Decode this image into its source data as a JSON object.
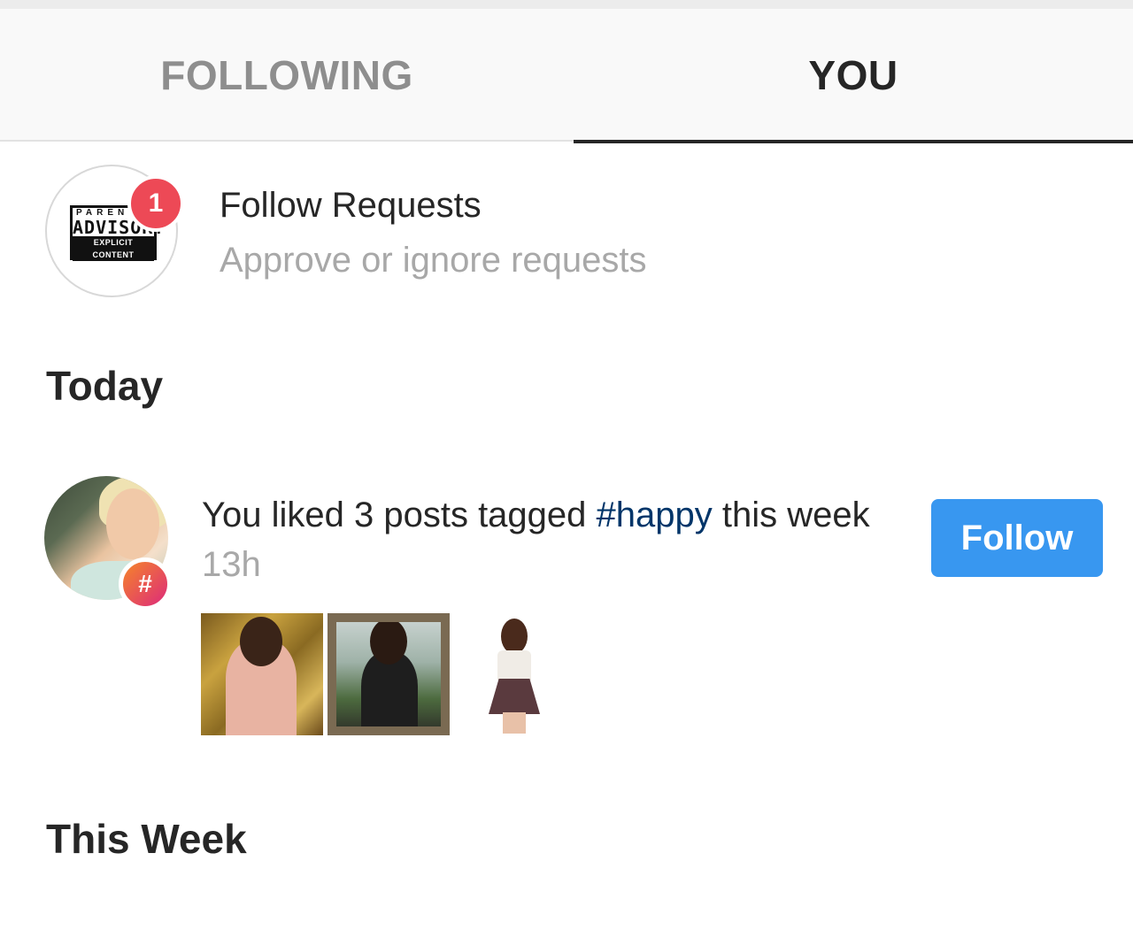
{
  "tabs": {
    "following_label": "FOLLOWING",
    "you_label": "YOU",
    "active": "YOU"
  },
  "follow_requests": {
    "title": "Follow Requests",
    "subtitle": "Approve or ignore requests",
    "badge_count": "1",
    "avatar_logo": {
      "line1": "PARENTAL",
      "line2": "ADVISORY",
      "line3": "EXPLICIT CONTENT"
    }
  },
  "sections": {
    "today": "Today",
    "this_week": "This Week"
  },
  "activity": {
    "text_before": "You liked 3 posts tagged ",
    "hashtag": "#happy",
    "text_after": " this week",
    "time": "13h",
    "follow_label": "Follow",
    "badge_symbol": "#",
    "follow_color": "#3897f0",
    "hashtag_color": "#003569"
  },
  "badge_color": "#ed4956"
}
